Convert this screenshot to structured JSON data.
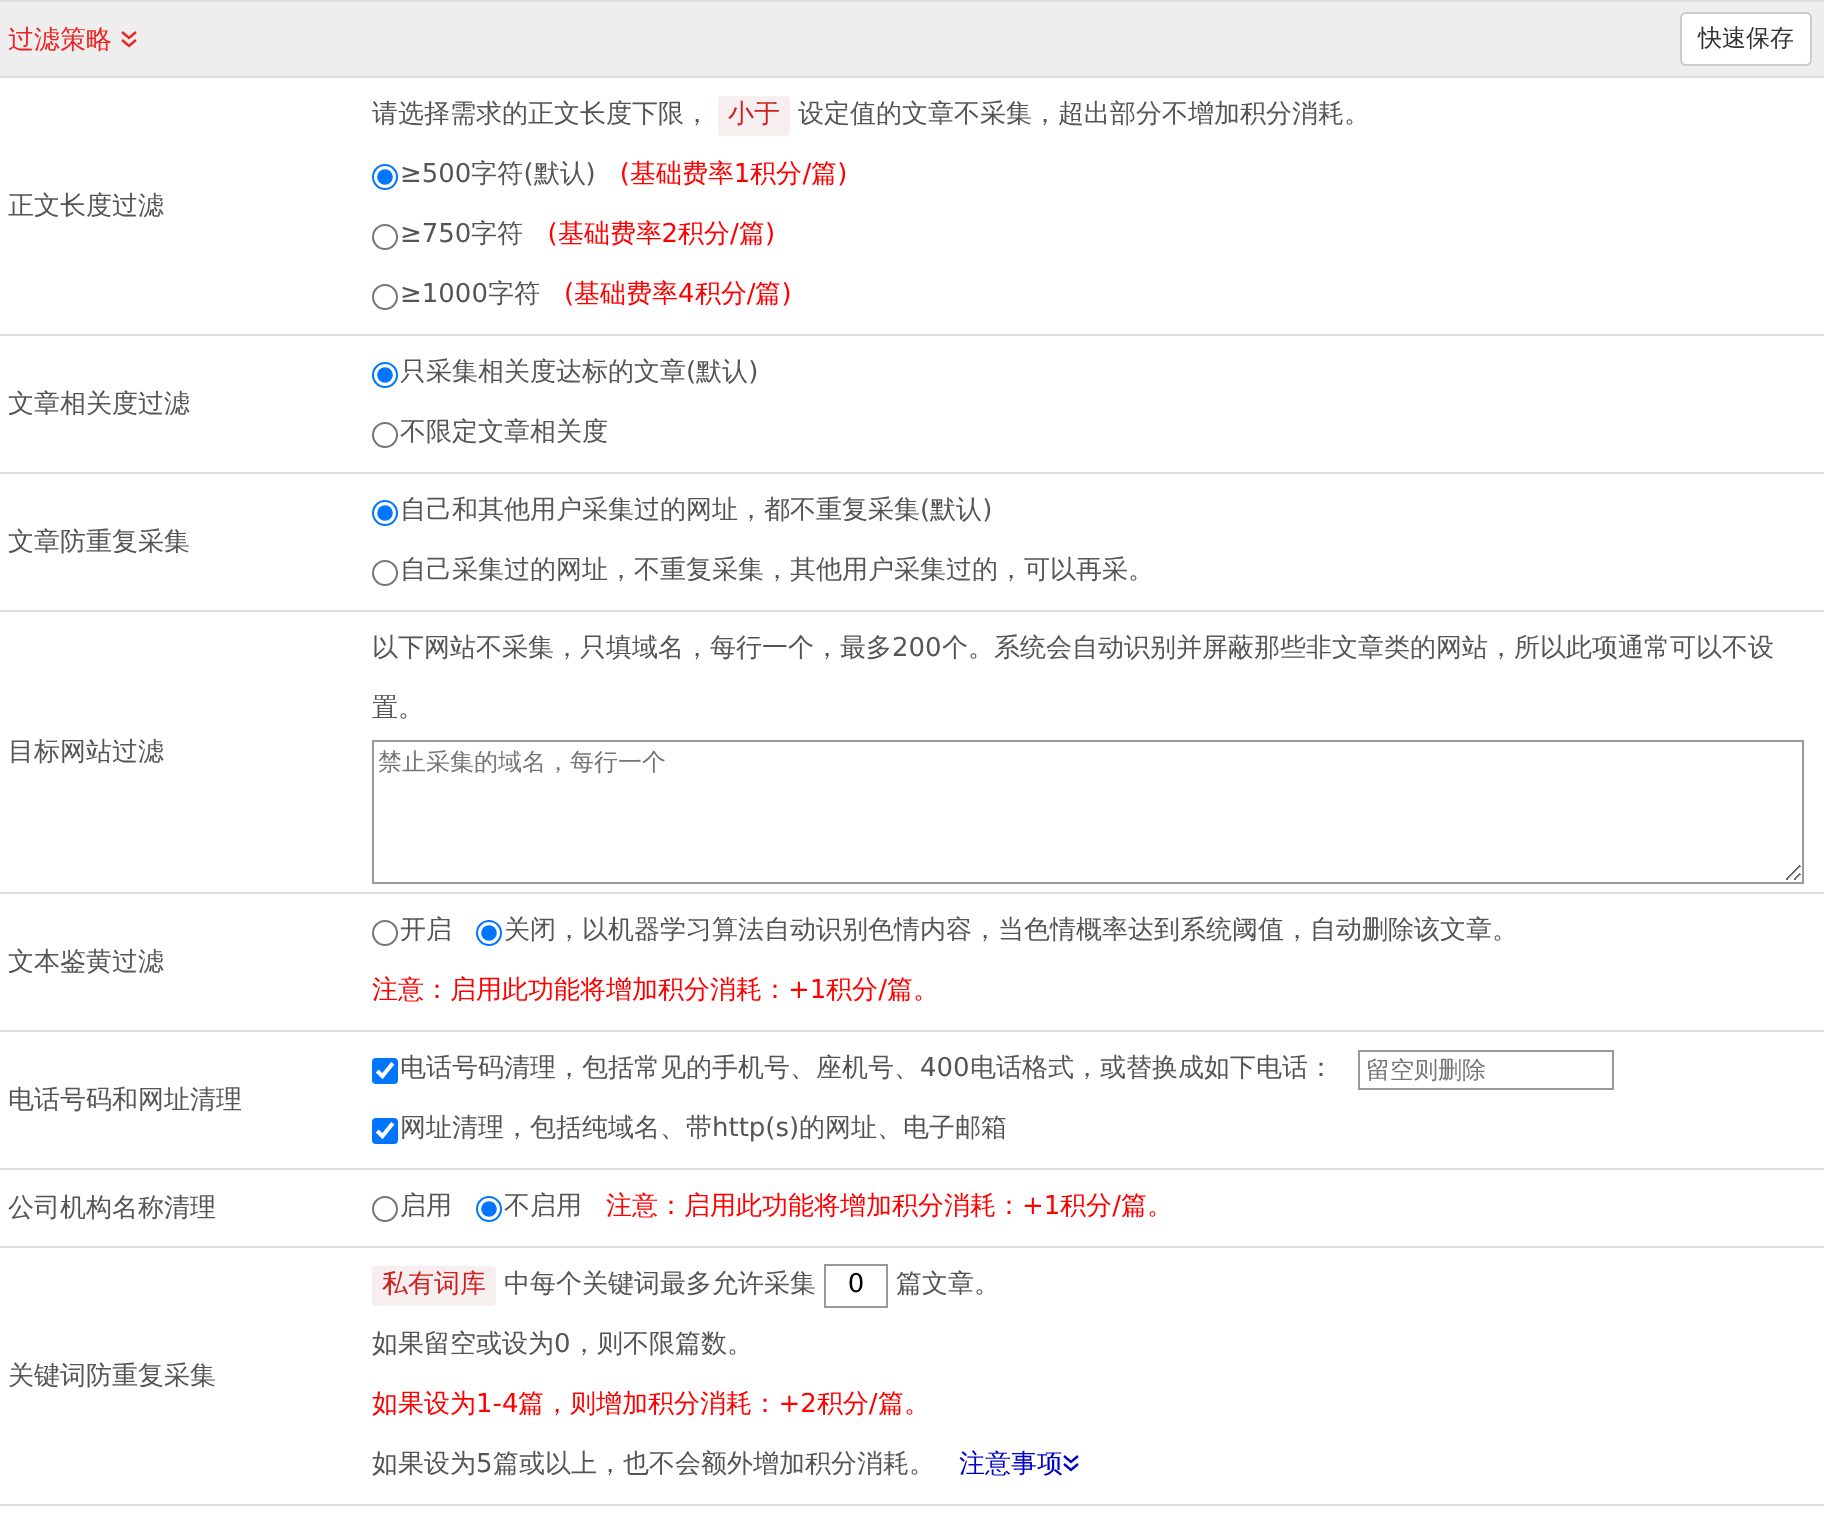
{
  "header": {
    "title": "过滤策略",
    "save_button": "快速保存"
  },
  "rows": [
    {
      "label": "正文长度过滤",
      "lines": [
        [
          {
            "kind": "plain",
            "text": "请选择需求的正文长度下限，"
          },
          {
            "kind": "tag",
            "text": "小于"
          },
          {
            "kind": "plain",
            "text": "设定值的文章不采集，超出部分不增加积分消耗。"
          }
        ],
        [
          {
            "kind": "radio",
            "text": "≥500字符(默认)",
            "selected": true
          },
          {
            "kind": "warning",
            "text": "(基础费率1积分/篇)"
          }
        ],
        [
          {
            "kind": "radio",
            "text": "≥750字符",
            "selected": false
          },
          {
            "kind": "warning",
            "text": "(基础费率2积分/篇)"
          }
        ],
        [
          {
            "kind": "radio",
            "text": "≥1000字符",
            "selected": false
          },
          {
            "kind": "warning",
            "text": "(基础费率4积分/篇)"
          }
        ]
      ]
    },
    {
      "label": "文章相关度过滤",
      "lines": [
        [
          {
            "kind": "radio",
            "text": "只采集相关度达标的文章(默认)",
            "selected": true
          }
        ],
        [
          {
            "kind": "radio",
            "text": "不限定文章相关度",
            "selected": false
          }
        ]
      ]
    },
    {
      "label": "文章防重复采集",
      "lines": [
        [
          {
            "kind": "radio",
            "text": "自己和其他用户采集过的网址，都不重复采集(默认)",
            "selected": true
          }
        ],
        [
          {
            "kind": "radio",
            "text": "自己采集过的网址，不重复采集，其他用户采集过的，可以再采。",
            "selected": false
          }
        ]
      ]
    },
    {
      "label": "目标网站过滤",
      "lines": [
        [
          {
            "kind": "plain",
            "text": "以下网站不采集，只填域名，每行一个，最多200个。系统会自动识别并屏蔽那些非文章类的网站，所以此项通常可以不设置。"
          }
        ],
        [
          {
            "kind": "textarea",
            "placeholder": "禁止采集的域名，每行一个"
          }
        ]
      ]
    },
    {
      "label": "文本鉴黄过滤",
      "lines": [
        [
          {
            "kind": "radio",
            "text": "开启",
            "selected": false
          },
          {
            "kind": "radio",
            "text": "关闭，以机器学习算法自动识别色情内容，当色情概率达到系统阈值，自动删除该文章。",
            "selected": true
          }
        ],
        [
          {
            "kind": "warning",
            "text": "注意：启用此功能将增加积分消耗：+1积分/篇。"
          }
        ]
      ]
    },
    {
      "label": "电话号码和网址清理",
      "lines": [
        [
          {
            "kind": "checkbox",
            "text": "电话号码清理，包括常见的手机号、座机号、400电话格式，或替换成如下电话：",
            "checked": true
          },
          {
            "kind": "input",
            "placeholder": "留空则删除"
          }
        ],
        [
          {
            "kind": "checkbox",
            "text": "网址清理，包括纯域名、带http(s)的网址、电子邮箱",
            "checked": true
          }
        ]
      ]
    },
    {
      "label": "公司机构名称清理",
      "lines": [
        [
          {
            "kind": "radio",
            "text": "启用",
            "selected": false
          },
          {
            "kind": "radio",
            "text": "不启用",
            "selected": true
          },
          {
            "kind": "warning",
            "text": "注意：启用此功能将增加积分消耗：+1积分/篇。"
          }
        ]
      ]
    },
    {
      "label": "关键词防重复采集",
      "lines": [
        [
          {
            "kind": "tag",
            "text": "私有词库"
          },
          {
            "kind": "plain",
            "text": "中每个关键词最多允许采集"
          },
          {
            "kind": "number",
            "value": "0"
          },
          {
            "kind": "plain",
            "text": "篇文章。"
          }
        ],
        [
          {
            "kind": "plain",
            "text": "如果留空或设为0，则不限篇数。"
          }
        ],
        [
          {
            "kind": "warning",
            "text": "如果设为1-4篇，则增加积分消耗：+2积分/篇。"
          }
        ],
        [
          {
            "kind": "plain",
            "text": "如果设为5篇或以上，也不会额外增加积分消耗。"
          },
          {
            "kind": "link",
            "text": "注意事项"
          }
        ]
      ]
    }
  ]
}
